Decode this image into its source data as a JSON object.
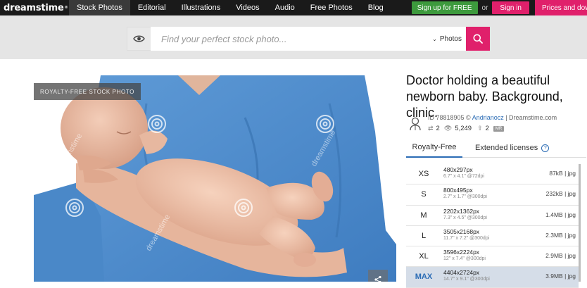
{
  "brand": {
    "logo_text": "dreamstime",
    "logo_mark": "®"
  },
  "nav": {
    "items": [
      {
        "label": "Stock Photos",
        "active": true
      },
      {
        "label": "Editorial"
      },
      {
        "label": "Illustrations"
      },
      {
        "label": "Videos"
      },
      {
        "label": "Audio"
      },
      {
        "label": "Free Photos"
      },
      {
        "label": "Blog"
      }
    ]
  },
  "auth": {
    "signup_label": "Sign up for FREE",
    "or_label": "or",
    "signin_label": "Sign in",
    "pricing_label": "Prices and downloads"
  },
  "search": {
    "placeholder": "Find your perfect stock photo...",
    "type_value": "Photos"
  },
  "image": {
    "badge": "ROYALTY-FREE STOCK PHOTO",
    "watermark": "dreamstime"
  },
  "details": {
    "title": "Doctor holding a beautiful newborn baby. Background, clinic.",
    "id_prefix": "ID 78818905 © ",
    "author": "Andrianocz",
    "source": " | Dreamstime.com",
    "stats": {
      "similar": "2",
      "views": "5,249",
      "downloads": "2",
      "badge": "MR"
    }
  },
  "tabs": {
    "royalty_free": "Royalty-Free",
    "extended": "Extended licenses",
    "info": "?"
  },
  "sizes": [
    {
      "code": "XS",
      "px": "480x297px",
      "inch": "6.7\" x 4.1\" @72dpi",
      "file": "87kB | jpg"
    },
    {
      "code": "S",
      "px": "800x495px",
      "inch": "2.7\" x 1.7\" @300dpi",
      "file": "232kB | jpg"
    },
    {
      "code": "M",
      "px": "2202x1362px",
      "inch": "7.3\" x 4.5\" @300dpi",
      "file": "1.4MB | jpg"
    },
    {
      "code": "L",
      "px": "3505x2168px",
      "inch": "11.7\" x 7.2\" @300dpi",
      "file": "2.3MB | jpg"
    },
    {
      "code": "XL",
      "px": "3596x2224px",
      "inch": "12\" x 7.4\" @300dpi",
      "file": "2.9MB | jpg"
    },
    {
      "code": "MAX",
      "px": "4404x2724px",
      "inch": "14.7\" x 9.1\" @300dpi",
      "file": "3.9MB | jpg",
      "selected": true
    }
  ],
  "colors": {
    "accent_pink": "#e0206b",
    "signup_green": "#3d9a3d",
    "link_blue": "#2b6cb5",
    "scrubs_blue": "#4f8fd0"
  }
}
